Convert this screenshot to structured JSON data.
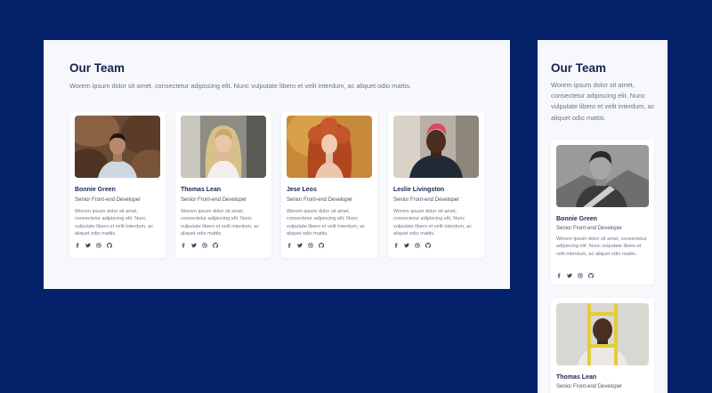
{
  "desktop": {
    "title": "Our Team",
    "intro": "Worem ipsum dolor sit amet, consectetur adipiscing elit. Nunc vulputate libero et velit interdum, ac aliquet odio mattis.",
    "members": [
      {
        "name": "Bonnie Green",
        "role": "Senior Front-end Developer",
        "bio": "Worem ipsum dolor sit amet, consectetur adipiscing elit. Nunc vulputate libero et velit interdum, ac aliquet odio mattis."
      },
      {
        "name": "Thomas Lean",
        "role": "Senior Front-end Developer",
        "bio": "Worem ipsum dolor sit amet, consectetur adipiscing elit. Nunc vulputate libero et velit interdum, ac aliquet odio mattis."
      },
      {
        "name": "Jese Leos",
        "role": "Senior Front-end Developer",
        "bio": "Worem ipsum dolor sit amet, consectetur adipiscing elit. Nunc vulputate libero et velit interdum, ac aliquet odio mattis."
      },
      {
        "name": "Leslie Livingston",
        "role": "Senior Front-end Developer",
        "bio": "Worem ipsum dolor sit amet, consectetur adipiscing elit. Nunc vulputate libero et velit interdum, ac aliquet odio mattis."
      }
    ]
  },
  "mobile": {
    "title": "Our Team",
    "intro": "Worem ipsum dolor sit amet, consectetur adipiscing elit. Nunc vulputate libero et velit interdum, ac aliquet odio mattis.",
    "members": [
      {
        "name": "Bonnie Green",
        "role": "Senior Front-end Developer",
        "bio": "Worem ipsum dolor sit amet, consectetur adipiscing elit. Nunc vulputate libero et velit interdum, ac aliquet odio mattis."
      },
      {
        "name": "Thomas Lean",
        "role": "Senior Front-end Developer"
      }
    ]
  },
  "social_icons": [
    "facebook-icon",
    "twitter-icon",
    "dribbble-icon",
    "github-icon"
  ],
  "colors": {
    "page_background": "#04226a",
    "panel_background": "#f7f8fb",
    "heading": "#15254f",
    "body_text": "#6b7385"
  }
}
